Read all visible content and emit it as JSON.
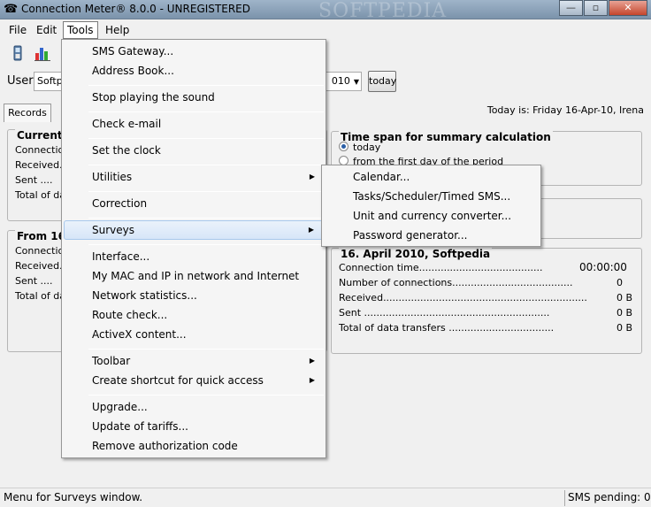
{
  "window": {
    "title": "Connection Meter® 8.0.0 - UNREGISTERED",
    "watermark": "SOFTPEDIA",
    "controls": [
      "—",
      "▫",
      "✕"
    ]
  },
  "menubar": [
    "File",
    "Edit",
    "Tools",
    "Help"
  ],
  "user_row": {
    "label": "User",
    "user_value": "Softpedia",
    "date_value": "010",
    "today_button": "today"
  },
  "tabs": {
    "records": "Records",
    "today_is": "Today is: Friday 16-Apr-10, Irena"
  },
  "left_panel_1": {
    "title": "Current c",
    "rows": [
      "Connection",
      "Received..",
      "Sent      ....",
      "Total of dat"
    ]
  },
  "left_panel_2": {
    "title": "From 16-",
    "rows": [
      "Connection",
      "Received..",
      "Sent      ....",
      "Total of dat"
    ]
  },
  "timespan": {
    "title": "Time span for summary calculation",
    "options": [
      "today",
      "from the first day of the period"
    ]
  },
  "summary": {
    "title": "16. April 2010, Softpedia",
    "rows": [
      {
        "label": "Connection time",
        "value": "00:00:00"
      },
      {
        "label": "Number of connections",
        "value": "0"
      },
      {
        "label": "Received",
        "value": "0 B"
      },
      {
        "label": "Sent",
        "value": "0 B"
      },
      {
        "label": "Total of data transfers",
        "value": "0 B"
      }
    ]
  },
  "tools_menu": {
    "sms_gateway": "SMS Gateway...",
    "address_book": "Address Book...",
    "stop_sound": "Stop playing the sound",
    "check_email": "Check e-mail",
    "set_clock": "Set the clock",
    "utilities": "Utilities",
    "correction": "Correction",
    "surveys": "Surveys",
    "interface": "Interface...",
    "my_mac_ip": "My MAC and IP in network and Internet",
    "network_stats": "Network statistics...",
    "route_check": "Route check...",
    "activex": "ActiveX content...",
    "toolbar": "Toolbar",
    "create_shortcut": "Create shortcut for quick access",
    "upgrade": "Upgrade...",
    "update_tariffs": "Update of tariffs...",
    "remove_auth": "Remove authorization code"
  },
  "surveys_submenu": {
    "calendar": "Calendar...",
    "tasks": "Tasks/Scheduler/Timed SMS...",
    "unit_converter": "Unit and currency converter...",
    "password_gen": "Password generator..."
  },
  "statusbar": {
    "message": "Menu for Surveys window.",
    "sms_pending": "SMS pending: 0"
  },
  "colors": {
    "titlebar": "#8aa0b6",
    "highlight": "#d7e6f8",
    "radio_dot": "#2a5fa6"
  }
}
